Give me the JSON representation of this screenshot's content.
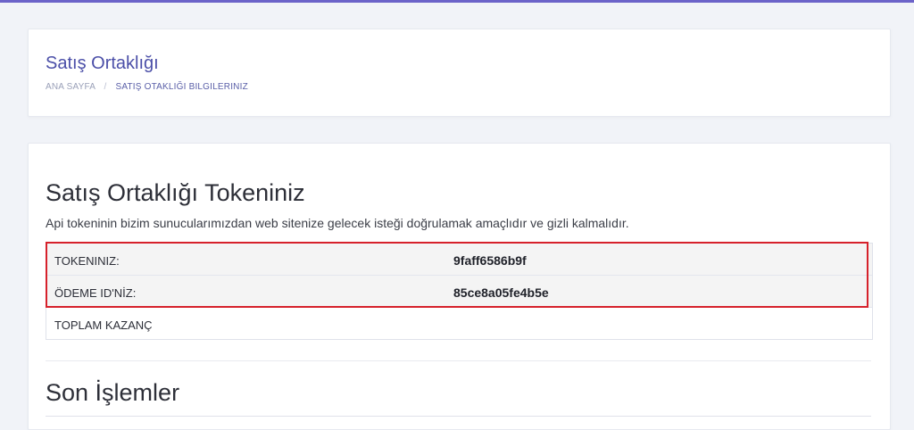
{
  "header": {
    "title": "Satış Ortaklığı",
    "breadcrumb": {
      "home": "ANA SAYFA",
      "separator": "/",
      "current": "SATIŞ OTAKLIĞI BILGILERINIZ"
    }
  },
  "token_section": {
    "title": "Satış Ortaklığı Tokeniniz",
    "description": "Api tokeninin bizim sunucularımızdan web sitenize gelecek isteği doğrulamak amaçlıdır ve gizli kalmalıdır.",
    "rows": [
      {
        "label": "TOKENINIZ:",
        "value": "9faff6586b9f"
      },
      {
        "label": "ÖDEME ID'NİZ:",
        "value": "85ce8a05fe4b5e"
      },
      {
        "label": "TOPLAM KAZANÇ",
        "value": ""
      }
    ]
  },
  "recent_section": {
    "title": "Son İşlemler"
  },
  "colors": {
    "accent": "#6c63c9",
    "title": "#4b4fa8",
    "highlight_border": "#d6212b"
  }
}
